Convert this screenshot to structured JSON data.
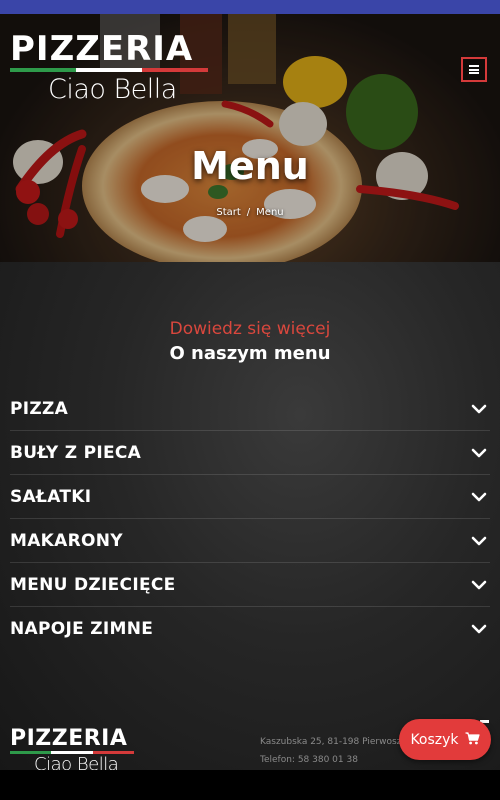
{
  "colors": {
    "status_bar": "#3a45a8",
    "accent_red": "#d9473d",
    "cart_button": "#e23b3b",
    "flag_green": "#2e9a4a",
    "flag_white": "#ffffff",
    "flag_red": "#d43a3a"
  },
  "brand": {
    "name_top": "PIZZERIA",
    "name_bottom": "Ciao Bella"
  },
  "header": {
    "menu_icon": "hamburger-icon"
  },
  "hero": {
    "title": "Menu",
    "breadcrumb": {
      "home": "Start",
      "separator": "/",
      "current": "Menu"
    }
  },
  "section": {
    "subtitle": "Dowiedz się więcej",
    "title": "O naszym menu"
  },
  "accordion": [
    {
      "label": "PIZZA",
      "icon": "chevron-down-icon"
    },
    {
      "label": "BUŁY Z PIECA",
      "icon": "chevron-down-icon"
    },
    {
      "label": "SAŁATKI",
      "icon": "chevron-down-icon"
    },
    {
      "label": "MAKARONY",
      "icon": "chevron-down-icon"
    },
    {
      "label": "MENU DZIECIĘCE",
      "icon": "chevron-down-icon"
    },
    {
      "label": "NAPOJE ZIMNE",
      "icon": "chevron-down-icon"
    }
  ],
  "footer": {
    "address": "Kaszubska 25, 81-198 Pierwoszyno",
    "phone": "Telefon: 58 380 01 38"
  },
  "cart": {
    "label": "Koszyk",
    "icon": "cart-icon"
  }
}
